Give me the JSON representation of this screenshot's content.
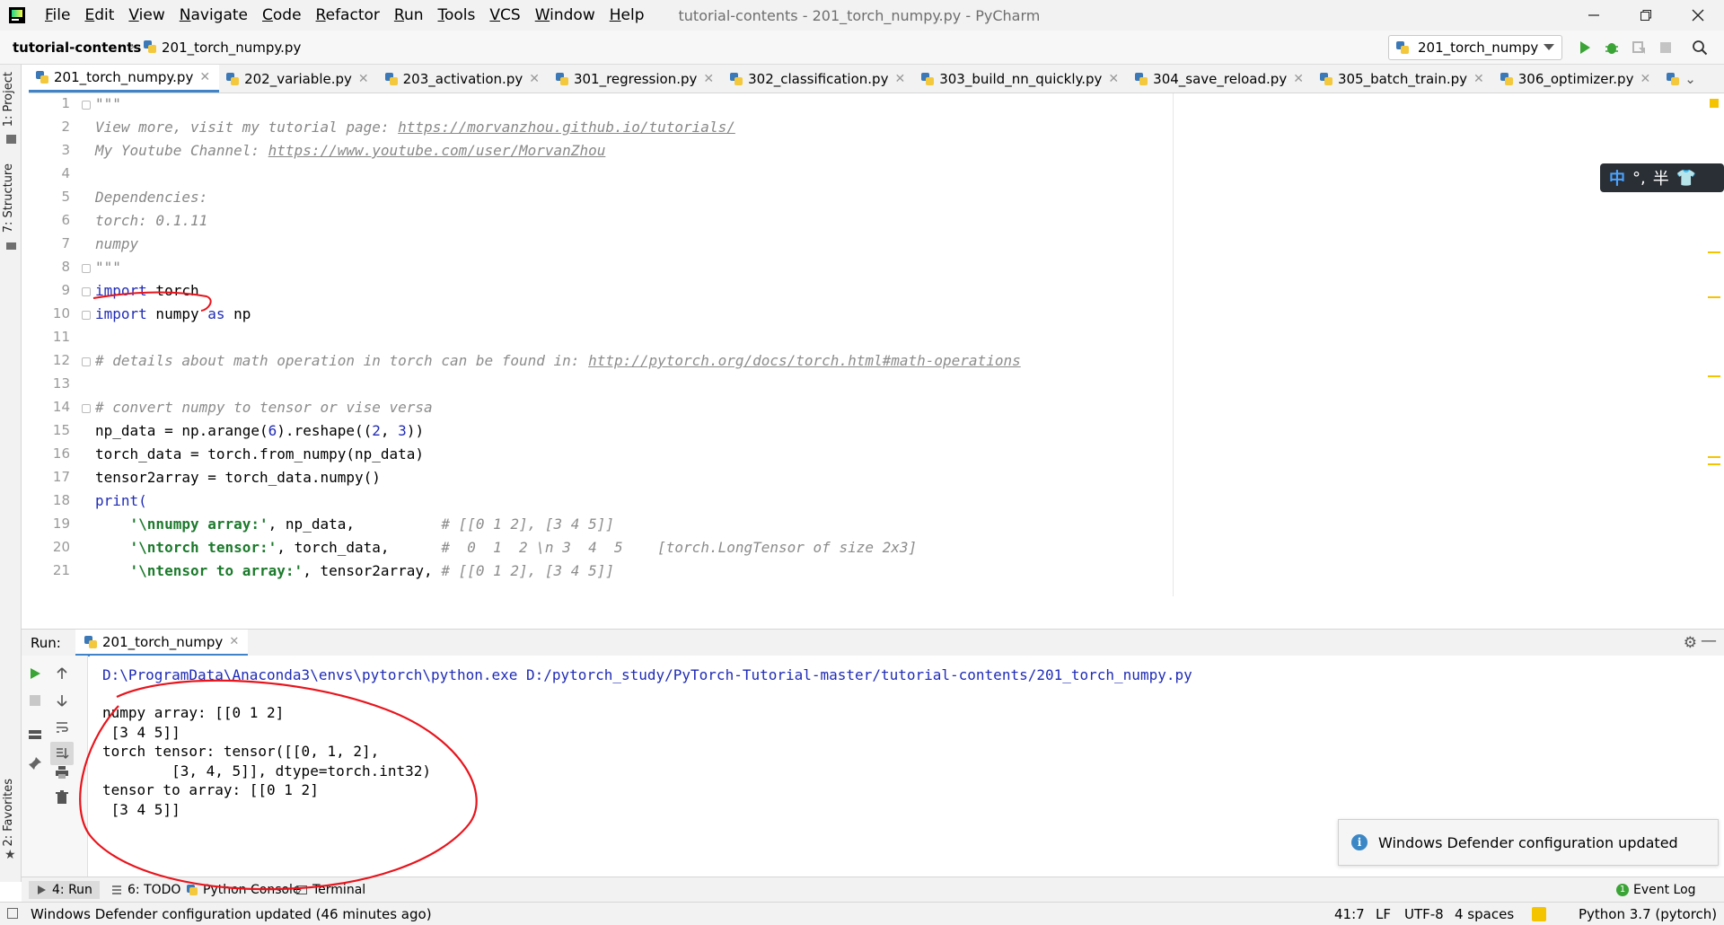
{
  "app": {
    "window_title": "tutorial-contents - 201_torch_numpy.py - PyCharm",
    "menu": [
      "File",
      "Edit",
      "View",
      "Navigate",
      "Code",
      "Refactor",
      "Run",
      "Tools",
      "VCS",
      "Window",
      "Help"
    ]
  },
  "navbar": {
    "project": "tutorial-contents",
    "file": "201_torch_numpy.py",
    "run_config": "201_torch_numpy"
  },
  "tabs": [
    {
      "label": "201_torch_numpy.py",
      "active": true
    },
    {
      "label": "202_variable.py"
    },
    {
      "label": "203_activation.py"
    },
    {
      "label": "301_regression.py"
    },
    {
      "label": "302_classification.py"
    },
    {
      "label": "303_build_nn_quickly.py"
    },
    {
      "label": "304_save_reload.py"
    },
    {
      "label": "305_batch_train.py"
    },
    {
      "label": "306_optimizer.py"
    }
  ],
  "left_strip": {
    "project": "1: Project",
    "structure": "7: Structure",
    "favorites": "2: Favorites"
  },
  "editor": {
    "line_numbers": [
      "1",
      "2",
      "3",
      "4",
      "5",
      "6",
      "7",
      "8",
      "9",
      "10",
      "11",
      "12",
      "13",
      "14",
      "15",
      "16",
      "17",
      "18",
      "19",
      "20",
      "21"
    ],
    "lines": {
      "l1": "\"\"\"",
      "l2_prefix": "View more, visit my tutorial page: ",
      "l2_link": "https://morvanzhou.github.io/tutorials/",
      "l3_prefix": "My Youtube Channel: ",
      "l3_link": "https://www.youtube.com/user/MorvanZhou",
      "l5": "Dependencies:",
      "l6": "torch: 0.1.11",
      "l7": "numpy",
      "l8": "\"\"\"",
      "l9_kw": "import",
      "l9_rest": " torch",
      "l10_kw": "import",
      "l10_mid": " numpy ",
      "l10_kw2": "as",
      "l10_rest": " np",
      "l12_prefix": "# details about math operation in torch can be found in: ",
      "l12_link": "http://pytorch.org/docs/torch.html#math-operations",
      "l14": "# convert numpy to tensor or vise versa",
      "l15_a": "np_data = np.arange(",
      "l15_n1": "6",
      "l15_b": ").reshape((",
      "l15_n2": "2",
      "l15_c": ", ",
      "l15_n3": "3",
      "l15_d": "))",
      "l16": "torch_data = torch.from_numpy(np_data)",
      "l17": "tensor2array = torch_data.numpy()",
      "l18": "print(",
      "l19_str": "'\\nnumpy array:'",
      "l19_rest": ", np_data,          ",
      "l19_cmt": "# [[0 1 2], [3 4 5]]",
      "l20_str": "'\\ntorch tensor:'",
      "l20_rest": ", torch_data,      ",
      "l20_cmt": "#  0  1  2 \\n 3  4  5    [torch.LongTensor of size 2x3]",
      "l21_str": "'\\ntensor to array:'",
      "l21_rest": ", tensor2array, ",
      "l21_cmt": "# [[0 1 2], [3 4 5]]"
    }
  },
  "ime": {
    "zh": "中",
    "punct": "°,",
    "half": "半"
  },
  "run_panel": {
    "title": "Run:",
    "tab": "201_torch_numpy",
    "command": "D:\\ProgramData\\Anaconda3\\envs\\pytorch\\python.exe D:/pytorch_study/PyTorch-Tutorial-master/tutorial-contents/201_torch_numpy.py",
    "output": [
      "numpy array: [[0 1 2]",
      " [3 4 5]]",
      "torch tensor: tensor([[0, 1, 2],",
      "        [3, 4, 5]], dtype=torch.int32)",
      "tensor to array: [[0 1 2]",
      " [3 4 5]]"
    ]
  },
  "notification": {
    "text": "Windows Defender configuration updated"
  },
  "tool_tabs": {
    "run": "4: Run",
    "todo": "6: TODO",
    "python_console": "Python Console",
    "terminal": "Terminal",
    "event_log": "Event Log"
  },
  "statusbar": {
    "message": "Windows Defender configuration updated (46 minutes ago)",
    "position": "41:7",
    "line_sep": "LF",
    "encoding": "UTF-8",
    "indent": "4 spaces",
    "interpreter": "Python 3.7 (pytorch)"
  },
  "colors": {
    "accent": "#4083c9",
    "keyword": "#1f2bb6",
    "string": "#1c7a2c",
    "annotation": "#e8141c",
    "run_green": "#3ba436"
  }
}
